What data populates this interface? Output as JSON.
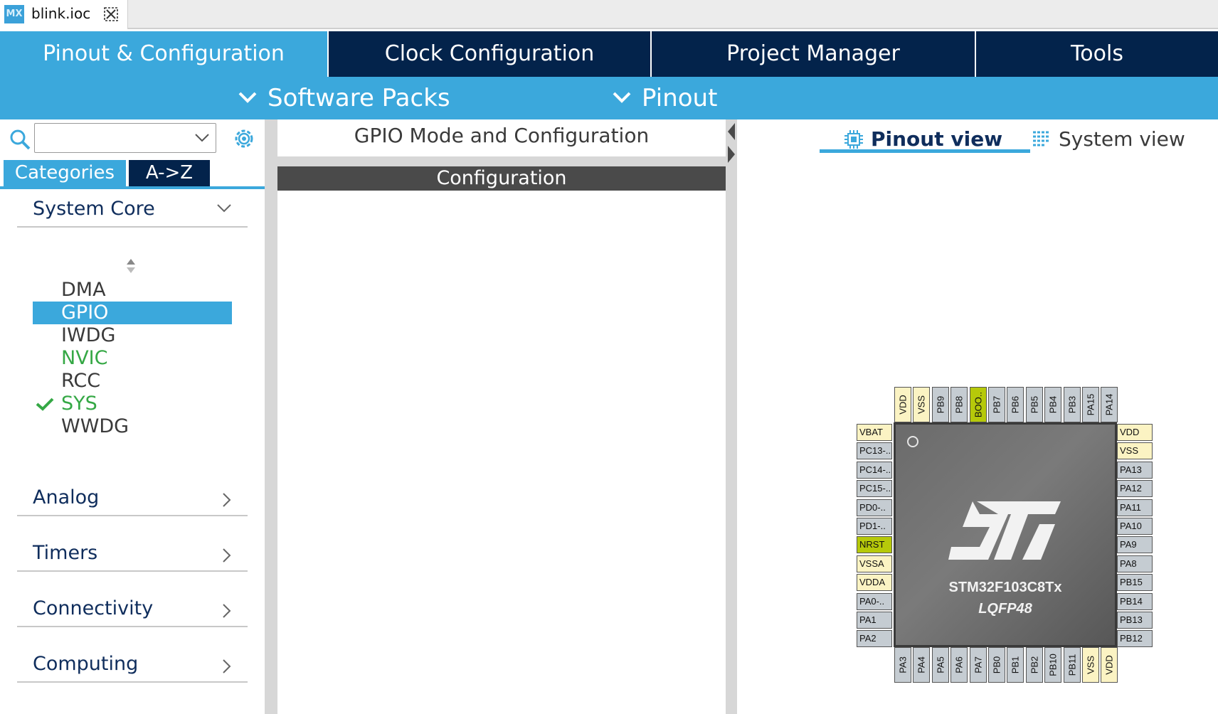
{
  "file_tab": {
    "icon_label": "MX",
    "filename": "blink.ioc"
  },
  "main_tabs": [
    {
      "label": "Pinout & Configuration",
      "active": true
    },
    {
      "label": "Clock Configuration",
      "active": false
    },
    {
      "label": "Project Manager",
      "active": false
    },
    {
      "label": "Tools",
      "active": false
    }
  ],
  "sub_toolbar": {
    "software_packs": "Software Packs",
    "pinout": "Pinout"
  },
  "left_panel": {
    "search": {
      "value": "",
      "placeholder": ""
    },
    "tabs": {
      "categories": "Categories",
      "az": "A->Z"
    },
    "sections": {
      "system_core": "System Core",
      "analog": "Analog",
      "timers": "Timers",
      "connectivity": "Connectivity",
      "computing": "Computing"
    },
    "system_core_items": [
      {
        "label": "DMA",
        "state": "normal"
      },
      {
        "label": "GPIO",
        "state": "selected"
      },
      {
        "label": "IWDG",
        "state": "normal"
      },
      {
        "label": "NVIC",
        "state": "green"
      },
      {
        "label": "RCC",
        "state": "normal"
      },
      {
        "label": "SYS",
        "state": "green-checked"
      },
      {
        "label": "WWDG",
        "state": "normal"
      }
    ]
  },
  "middle_panel": {
    "title": "GPIO Mode and Configuration",
    "config_header": "Configuration"
  },
  "right_panel": {
    "view_tabs": {
      "pinout_view": "Pinout view",
      "system_view": "System view"
    },
    "chip": {
      "name": "STM32F103C8Tx",
      "package": "LQFP48",
      "left_pins": [
        {
          "label": "VBAT",
          "type": "power"
        },
        {
          "label": "PC13-..",
          "type": "gray"
        },
        {
          "label": "PC14-..",
          "type": "gray"
        },
        {
          "label": "PC15-..",
          "type": "gray"
        },
        {
          "label": "PD0-..",
          "type": "gray"
        },
        {
          "label": "PD1-..",
          "type": "gray"
        },
        {
          "label": "NRST",
          "type": "green"
        },
        {
          "label": "VSSA",
          "type": "power"
        },
        {
          "label": "VDDA",
          "type": "power"
        },
        {
          "label": "PA0-..",
          "type": "gray"
        },
        {
          "label": "PA1",
          "type": "gray"
        },
        {
          "label": "PA2",
          "type": "gray"
        }
      ],
      "right_pins": [
        {
          "label": "VDD",
          "type": "power"
        },
        {
          "label": "VSS",
          "type": "power"
        },
        {
          "label": "PA13",
          "type": "gray"
        },
        {
          "label": "PA12",
          "type": "gray"
        },
        {
          "label": "PA11",
          "type": "gray"
        },
        {
          "label": "PA10",
          "type": "gray"
        },
        {
          "label": "PA9",
          "type": "gray"
        },
        {
          "label": "PA8",
          "type": "gray"
        },
        {
          "label": "PB15",
          "type": "gray"
        },
        {
          "label": "PB14",
          "type": "gray"
        },
        {
          "label": "PB13",
          "type": "gray"
        },
        {
          "label": "PB12",
          "type": "gray"
        }
      ],
      "top_pins": [
        {
          "label": "VDD",
          "type": "power"
        },
        {
          "label": "VSS",
          "type": "power"
        },
        {
          "label": "PB9",
          "type": "gray"
        },
        {
          "label": "PB8",
          "type": "gray"
        },
        {
          "label": "BOO..",
          "type": "green"
        },
        {
          "label": "PB7",
          "type": "gray"
        },
        {
          "label": "PB6",
          "type": "gray"
        },
        {
          "label": "PB5",
          "type": "gray"
        },
        {
          "label": "PB4",
          "type": "gray"
        },
        {
          "label": "PB3",
          "type": "gray"
        },
        {
          "label": "PA15",
          "type": "gray"
        },
        {
          "label": "PA14",
          "type": "gray"
        }
      ],
      "bottom_pins": [
        {
          "label": "PA3",
          "type": "gray"
        },
        {
          "label": "PA4",
          "type": "gray"
        },
        {
          "label": "PA5",
          "type": "gray"
        },
        {
          "label": "PA6",
          "type": "gray"
        },
        {
          "label": "PA7",
          "type": "gray"
        },
        {
          "label": "PB0",
          "type": "gray"
        },
        {
          "label": "PB1",
          "type": "gray"
        },
        {
          "label": "PB2",
          "type": "gray"
        },
        {
          "label": "PB10",
          "type": "gray"
        },
        {
          "label": "PB11",
          "type": "gray"
        },
        {
          "label": "VSS",
          "type": "power"
        },
        {
          "label": "VDD",
          "type": "power"
        }
      ]
    }
  },
  "colors": {
    "accent": "#3ba8dc",
    "navy": "#03234b",
    "green_text": "#35a845",
    "pin_green": "#b6c90a",
    "pin_power": "#fbf3c3",
    "pin_gray": "#c5ccd2"
  },
  "icons": [
    "mx-icon",
    "close-tab-icon",
    "chevron-down-icon",
    "search-icon",
    "gear-icon",
    "chevron-right-icon",
    "sort-arrows-icon",
    "check-icon",
    "chip-icon",
    "list-icon",
    "st-logo"
  ]
}
